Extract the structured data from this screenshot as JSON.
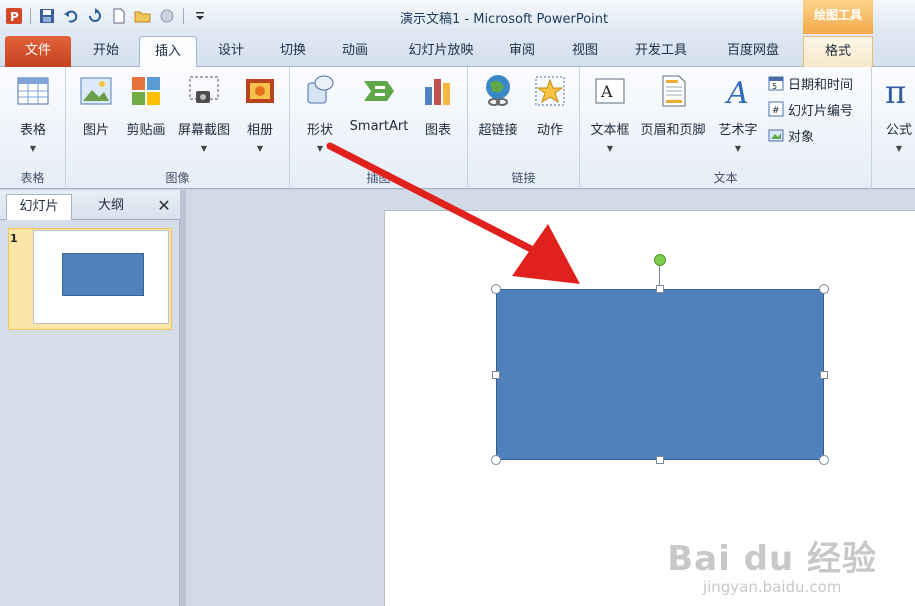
{
  "window": {
    "title": "演示文稿1 - Microsoft PowerPoint",
    "context_tab_title": "绘图工具"
  },
  "tabs": [
    {
      "label": "文件"
    },
    {
      "label": "开始"
    },
    {
      "label": "插入"
    },
    {
      "label": "设计"
    },
    {
      "label": "切换"
    },
    {
      "label": "动画"
    },
    {
      "label": "幻灯片放映"
    },
    {
      "label": "审阅"
    },
    {
      "label": "视图"
    },
    {
      "label": "开发工具"
    },
    {
      "label": "百度网盘"
    },
    {
      "label": "格式"
    }
  ],
  "ribbon": {
    "groups": {
      "table": "表格",
      "image": "图像",
      "illustrations": "插图",
      "links": "链接",
      "text": "文本"
    },
    "buttons": {
      "table": "表格",
      "picture": "图片",
      "clipart": "剪贴画",
      "screenshot": "屏幕截图",
      "album": "相册",
      "shapes": "形状",
      "smartart": "SmartArt",
      "chart": "图表",
      "hyperlink": "超链接",
      "action": "动作",
      "textbox": "文本框",
      "header_footer": "页眉和页脚",
      "wordart": "艺术字",
      "datetime": "日期和时间",
      "slide_number": "幻灯片编号",
      "object": "对象",
      "equation": "公式"
    }
  },
  "left_pane": {
    "tab_slides": "幻灯片",
    "tab_outline": "大纲",
    "close": "✕",
    "slide_number": "1"
  },
  "watermark": {
    "logo": "Bai du 经验",
    "url": "jingyan.baidu.com"
  },
  "colors": {
    "shape_fill": "#4f81bd",
    "file_tab": "#d24d2a",
    "arrow": "#e0211d"
  }
}
